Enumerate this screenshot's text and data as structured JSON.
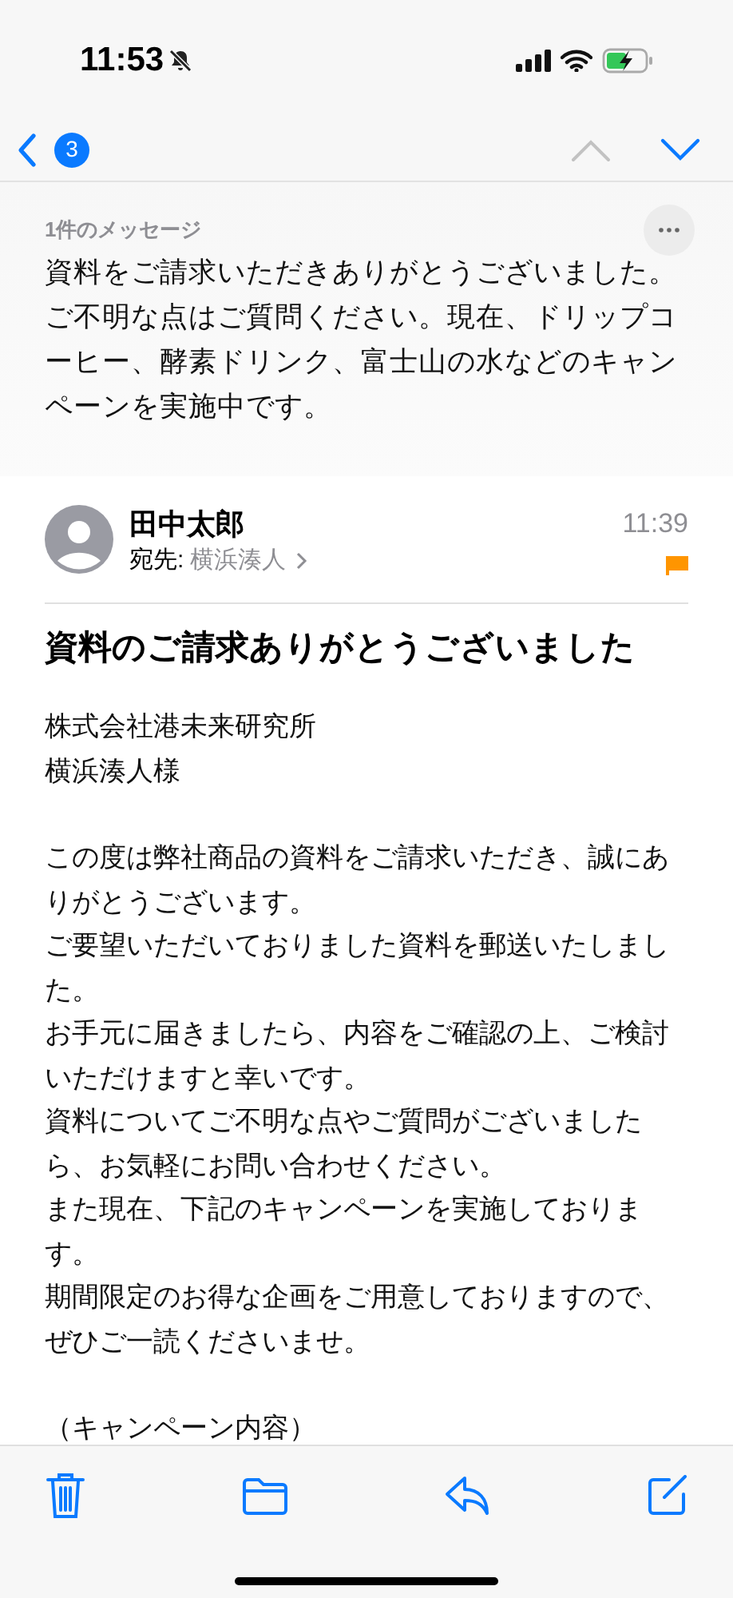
{
  "status_bar": {
    "time": "11:53",
    "silent": true
  },
  "nav": {
    "unread_count": "3"
  },
  "thread": {
    "count_label": "1件のメッセージ",
    "summary": "資料をご請求いただきありがとうございました。ご不明な点はご質問ください。現在、ドリップコーヒー、酵素ドリンク、富士山の水などのキャンペーンを実施中です。"
  },
  "message": {
    "sender": "田中太郎",
    "to_label": "宛先:",
    "recipient": "横浜湊人",
    "time": "11:39",
    "flagged": true,
    "subject": "資料のご請求ありがとうございました",
    "paragraphs": [
      [
        "株式会社港未来研究所",
        "横浜湊人様"
      ],
      [
        "この度は弊社商品の資料をご請求いただき、誠にありがとうございます。",
        "ご要望いただいておりました資料を郵送いたしました。",
        "お手元に届きましたら、内容をご確認の上、ご検討いただけますと幸いです。",
        "資料についてご不明な点やご質問がございましたら、お気軽にお問い合わせください。",
        "また現在、下記のキャンペーンを実施しております。",
        "期間限定のお得な企画をご用意しておりますので、ぜひご一読くださいませ。"
      ],
      [
        "（キャンペーン内容）"
      ]
    ]
  }
}
